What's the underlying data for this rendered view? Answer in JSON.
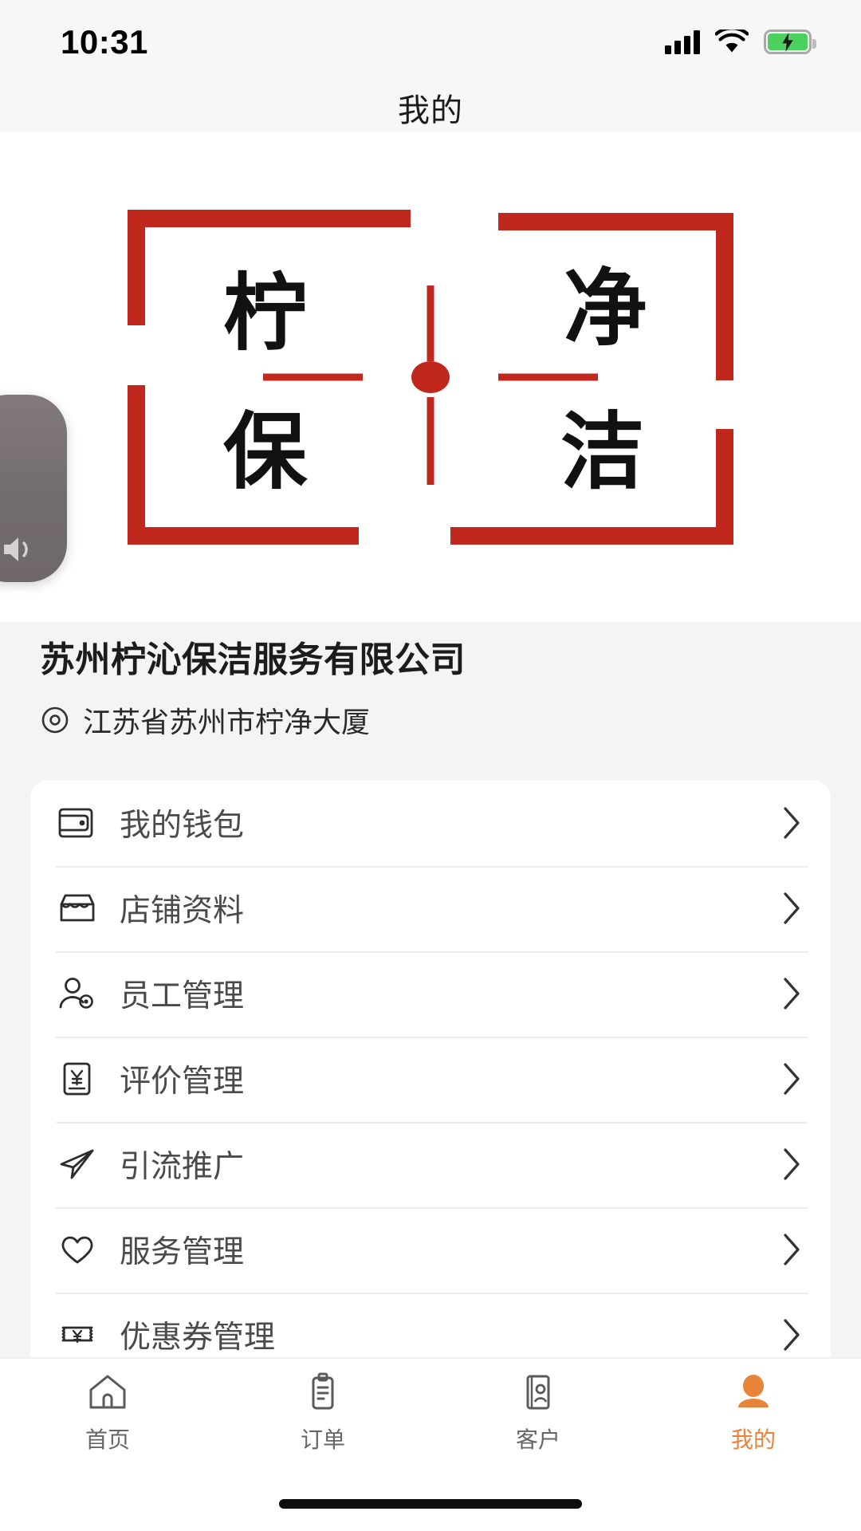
{
  "status_bar": {
    "time": "10:31",
    "icons": [
      "cellular-signal-icon",
      "wifi-icon",
      "battery-charging-icon"
    ]
  },
  "header": {
    "title": "我的"
  },
  "banner": {
    "logo_chars": [
      "柠",
      "净",
      "保",
      "洁"
    ],
    "logo_alt": "柠净保洁",
    "accent_color": "#c0271d"
  },
  "volume_hud": {
    "icon": "speaker-icon",
    "visible": true
  },
  "profile": {
    "company_name": "苏州柠沁保洁服务有限公司",
    "address": "江苏省苏州市柠净大厦",
    "address_icon": "location-pin-icon"
  },
  "menu": {
    "items": [
      {
        "label": "我的钱包",
        "icon": "wallet-icon",
        "chevron": "chevron-right-icon"
      },
      {
        "label": "店铺资料",
        "icon": "shop-icon",
        "chevron": "chevron-right-icon"
      },
      {
        "label": "员工管理",
        "icon": "user-gear-icon",
        "chevron": "chevron-right-icon"
      },
      {
        "label": "评价管理",
        "icon": "review-yen-document-icon",
        "chevron": "chevron-right-icon"
      },
      {
        "label": "引流推广",
        "icon": "paper-plane-icon",
        "chevron": "chevron-right-icon"
      },
      {
        "label": "服务管理",
        "icon": "heart-icon",
        "chevron": "chevron-right-icon"
      },
      {
        "label": "优惠券管理",
        "icon": "coupon-yen-icon",
        "chevron": "chevron-right-icon"
      }
    ]
  },
  "tabbar": {
    "active_color": "#e8833a",
    "inactive_color": "#666666",
    "tabs": [
      {
        "label": "首页",
        "icon": "home-icon",
        "active": false
      },
      {
        "label": "订单",
        "icon": "clipboard-icon",
        "active": false
      },
      {
        "label": "客户",
        "icon": "contact-card-icon",
        "active": false
      },
      {
        "label": "我的",
        "icon": "person-icon",
        "active": true
      }
    ]
  }
}
